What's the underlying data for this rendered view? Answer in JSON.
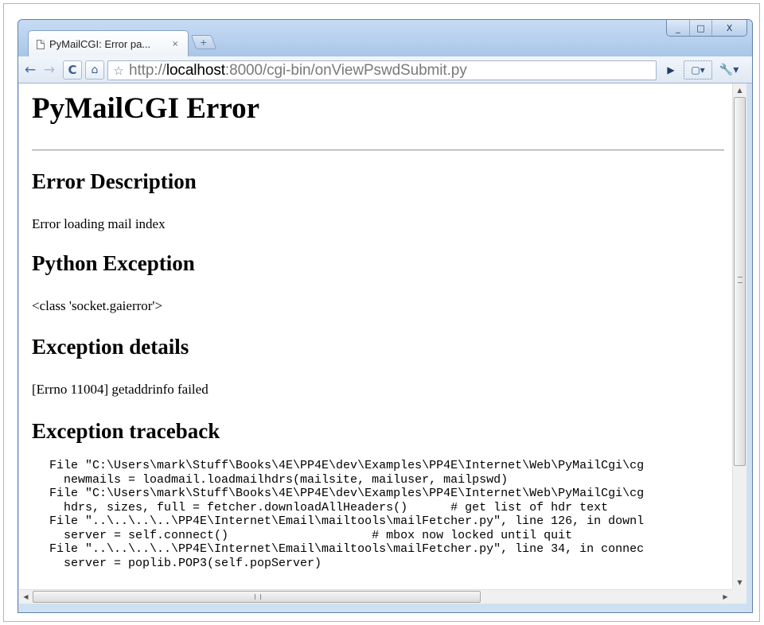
{
  "window": {
    "controls": {
      "minimize": "_",
      "maximize": "□",
      "close": "X"
    }
  },
  "tab": {
    "title": "PyMailCGI: Error pa...",
    "close": "×",
    "new_tab": "+"
  },
  "toolbar": {
    "back": "←",
    "forward": "→",
    "reload": "C",
    "home": "⌂",
    "star": "☆",
    "url_prefix": "http://",
    "url_host": "localhost",
    "url_rest": ":8000/cgi-bin/onViewPswdSubmit.py",
    "go": "▶",
    "page_menu": "▢▾",
    "wrench_menu": "🔧▾"
  },
  "page": {
    "title": "PyMailCGI Error",
    "sections": [
      {
        "heading": "Error Description",
        "text": "Error loading mail index"
      },
      {
        "heading": "Python Exception",
        "text": "<class 'socket.gaierror'>"
      },
      {
        "heading": "Exception details",
        "text": "[Errno 11004] getaddrinfo failed"
      },
      {
        "heading": "Exception traceback"
      }
    ],
    "traceback_lines": [
      "File \"C:\\Users\\mark\\Stuff\\Books\\4E\\PP4E\\dev\\Examples\\PP4E\\Internet\\Web\\PyMailCgi\\cg",
      "  newmails = loadmail.loadmailhdrs(mailsite, mailuser, mailpswd)",
      "File \"C:\\Users\\mark\\Stuff\\Books\\4E\\PP4E\\dev\\Examples\\PP4E\\Internet\\Web\\PyMailCgi\\cg",
      "  hdrs, sizes, full = fetcher.downloadAllHeaders()      # get list of hdr text",
      "File \"..\\..\\..\\..\\PP4E\\Internet\\Email\\mailtools\\mailFetcher.py\", line 126, in downl",
      "  server = self.connect()                    # mbox now locked until quit",
      "File \"..\\..\\..\\..\\PP4E\\Internet\\Email\\mailtools\\mailFetcher.py\", line 34, in connec",
      "  server = poplib.POP3(self.popServer)"
    ]
  },
  "scrollbars": {
    "up": "▲",
    "down": "▼",
    "left": "◀",
    "right": "▶",
    "h_grip": "III",
    "v_grip": "≡"
  }
}
